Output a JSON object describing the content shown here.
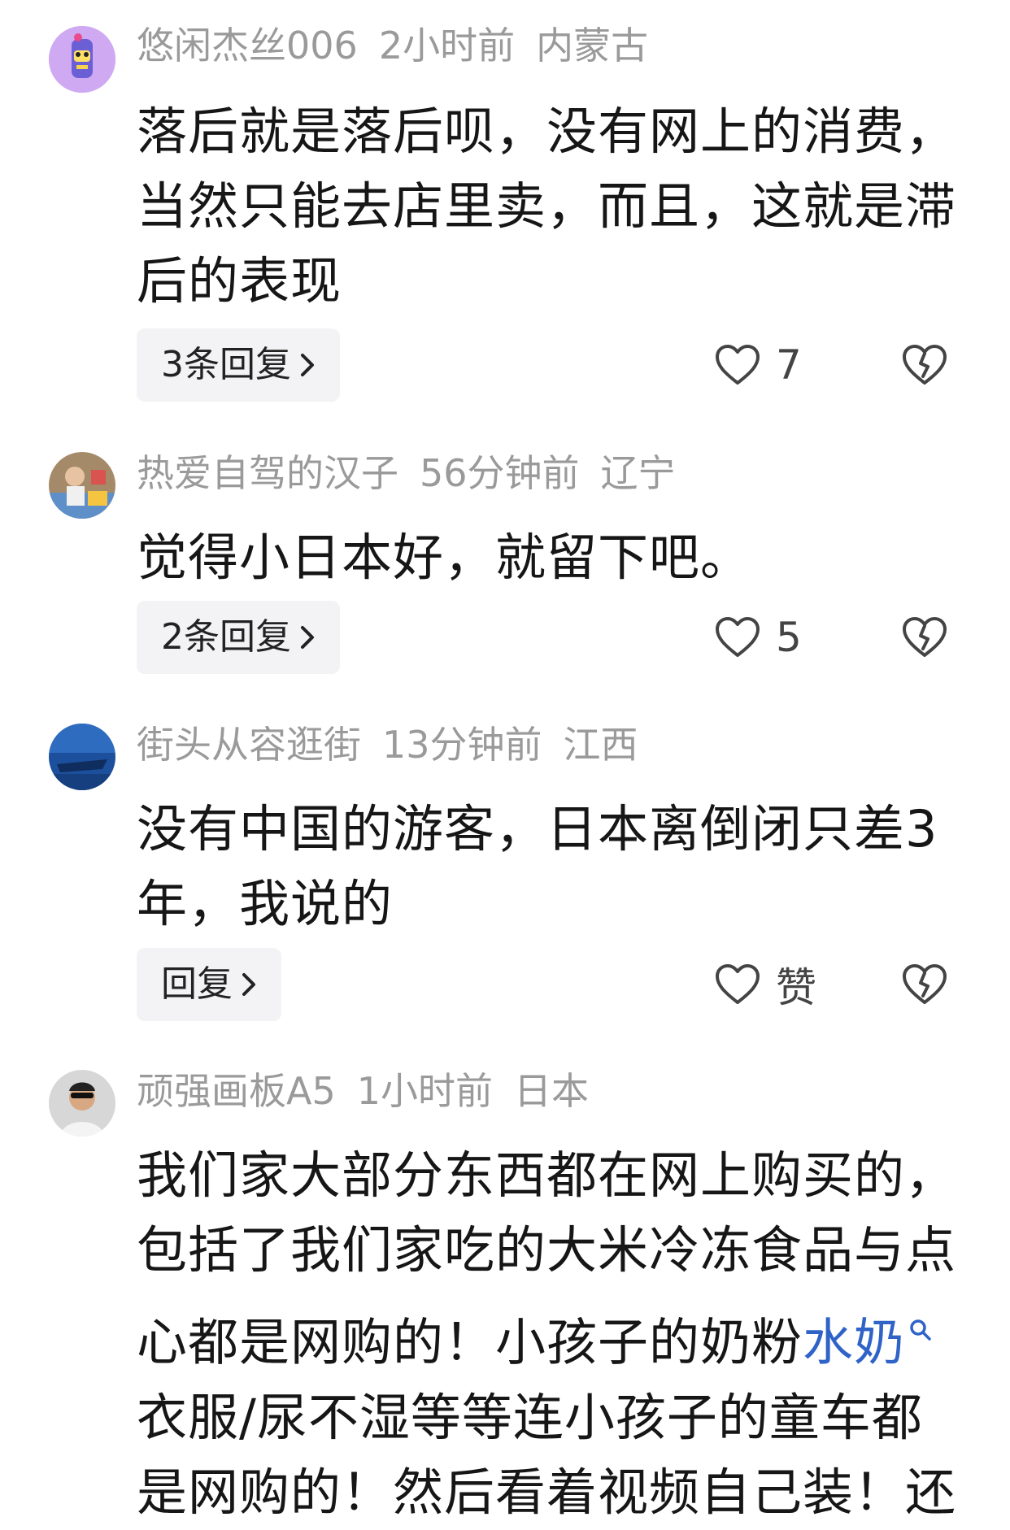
{
  "comments": [
    {
      "username": "悠闲杰丝006",
      "time": "2小时前",
      "location": "内蒙古",
      "lines": [
        "落后就是落后呗，没有网上的消费，",
        "当然只能去店里卖，而且，这就是滞",
        "后的表现"
      ],
      "reply_label": "3条回复",
      "likes": "7",
      "avatar_color": "#b98ae0"
    },
    {
      "username": "热爱自驾的汉子",
      "time": "56分钟前",
      "location": "辽宁",
      "lines": [
        "觉得小日本好，就留下吧。"
      ],
      "reply_label": "2条回复",
      "likes": "5",
      "avatar_color": "#9b7a5a"
    },
    {
      "username": "街头从容逛街",
      "time": "13分钟前",
      "location": "江西",
      "lines": [
        "没有中国的游客，日本离倒闭只差3",
        "年，我说的"
      ],
      "reply_label": "回复",
      "likes": "赞",
      "avatar_color": "#1d4f9a"
    },
    {
      "username": "顽强画板A5",
      "time": "1小时前",
      "location": "日本",
      "lines": [
        "我们家大部分东西都在网上购买的，",
        "包括了我们家吃的大米冷冻食品与点",
        "心都是网购的！小孩子的奶粉",
        "衣服/尿不湿等等连小孩子的童车都",
        "是网购的！然后看着视频自己装！还"
      ],
      "link_text": "水奶",
      "avatar_color": "#6d6d6d"
    }
  ],
  "colors": {
    "meta": "#9a9a9a",
    "link": "#2f63c8",
    "reply_bg": "#f3f3f5"
  },
  "icons": {
    "like": "heart-outline-icon",
    "dislike": "broken-heart-icon",
    "search": "search-icon",
    "chevron": "chevron-right-icon"
  }
}
